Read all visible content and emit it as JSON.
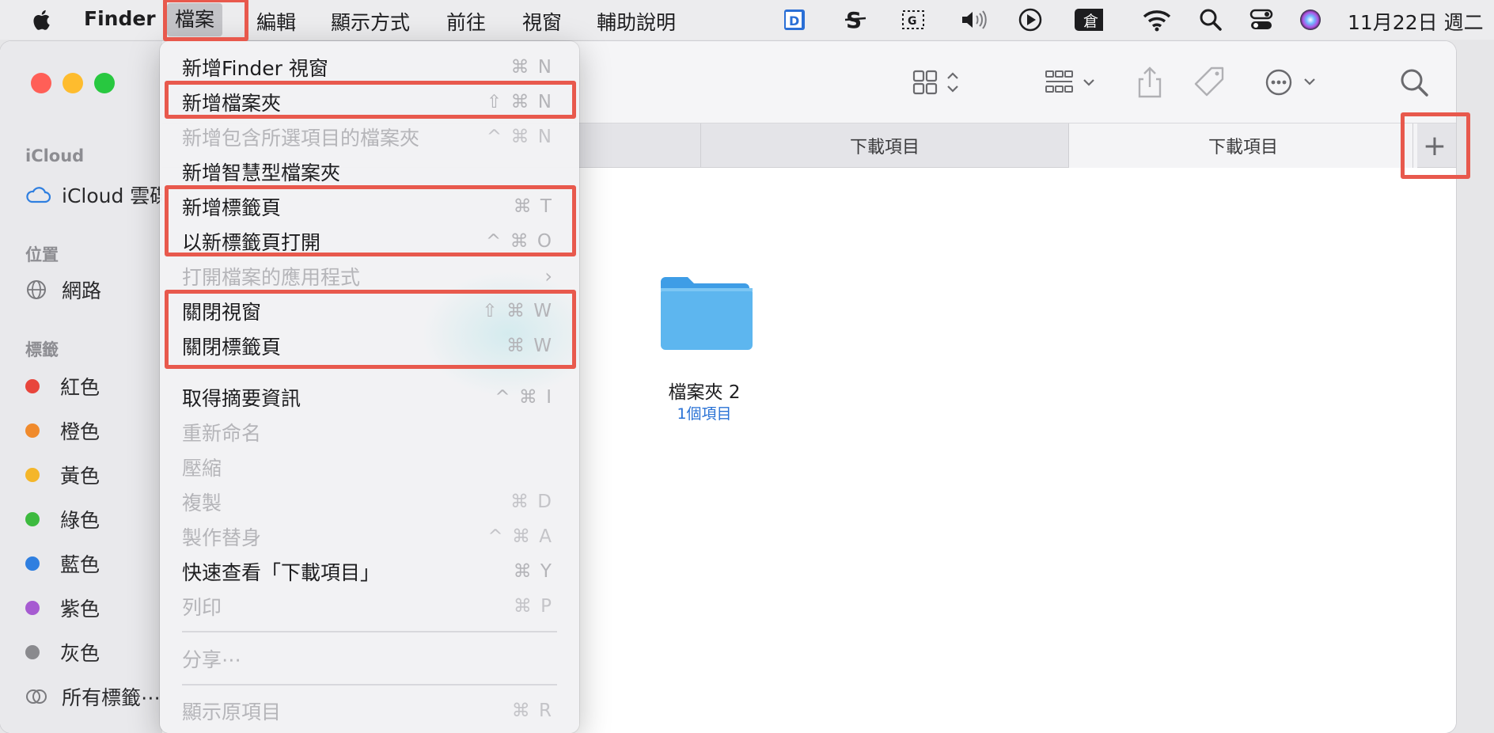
{
  "menubar": {
    "app_name": "Finder",
    "menus": [
      "檔案",
      "編輯",
      "顯示方式",
      "前往",
      "視窗",
      "輔助說明"
    ],
    "clock": "11月22日 週二"
  },
  "sidebar": {
    "sections": {
      "icloud": "iCloud",
      "locations": "位置",
      "tags": "標籤"
    },
    "icloud_drive": "iCloud 雲碟",
    "network": "網路",
    "tags": [
      {
        "label": "紅色",
        "color": "#e8453c"
      },
      {
        "label": "橙色",
        "color": "#f08a2c"
      },
      {
        "label": "黃色",
        "color": "#f4b62a"
      },
      {
        "label": "綠色",
        "color": "#3dba3f"
      },
      {
        "label": "藍色",
        "color": "#2f7fe0"
      },
      {
        "label": "紫色",
        "color": "#a65bd1"
      },
      {
        "label": "灰色",
        "color": "#8a8a8e"
      }
    ],
    "all_tags": "所有標籤⋯"
  },
  "tabs": [
    "下載項目",
    "下載項目"
  ],
  "add_tab": "+",
  "content": {
    "folder_name": "檔案夾 2",
    "folder_items": "1個項目"
  },
  "file_menu": {
    "items": [
      {
        "label": "新增Finder 視窗",
        "shortcut": "⌘ N",
        "disabled": false
      },
      {
        "label": "新增檔案夾",
        "shortcut": "⇧ ⌘ N",
        "disabled": false
      },
      {
        "label": "新增包含所選項目的檔案夾",
        "shortcut": "^ ⌘ N",
        "disabled": true
      },
      {
        "label": "新增智慧型檔案夾",
        "shortcut": "",
        "disabled": false
      },
      {
        "label": "新增標籤頁",
        "shortcut": "⌘ T",
        "disabled": false
      },
      {
        "label": "以新標籤頁打開",
        "shortcut": "^ ⌘ O",
        "disabled": false
      },
      {
        "label": "打開檔案的應用程式",
        "shortcut": "",
        "disabled": true
      },
      {
        "label": "關閉視窗",
        "shortcut": "⇧ ⌘ W",
        "disabled": false
      },
      {
        "label": "關閉標籤頁",
        "shortcut": "⌘ W",
        "disabled": false
      },
      {
        "label": "取得摘要資訊",
        "shortcut": "^ ⌘ I",
        "disabled": false
      },
      {
        "label": "重新命名",
        "shortcut": "",
        "disabled": true
      },
      {
        "label": "壓縮",
        "shortcut": "",
        "disabled": true
      },
      {
        "label": "複製",
        "shortcut": "⌘ D",
        "disabled": true
      },
      {
        "label": "製作替身",
        "shortcut": "^ ⌘ A",
        "disabled": true
      },
      {
        "label": "快速查看「下載項目」",
        "shortcut": "⌘ Y",
        "disabled": false
      },
      {
        "label": "列印",
        "shortcut": "⌘ P",
        "disabled": true
      },
      {
        "label": "分享⋯",
        "shortcut": "",
        "disabled": true
      },
      {
        "label": "顯示原項目",
        "shortcut": "⌘ R",
        "disabled": true
      }
    ]
  },
  "colors": {
    "highlight": "#e8594d",
    "folder": "#5db6ef",
    "close": "#ff5f57",
    "minimize": "#febc2e",
    "zoom": "#28c840"
  }
}
